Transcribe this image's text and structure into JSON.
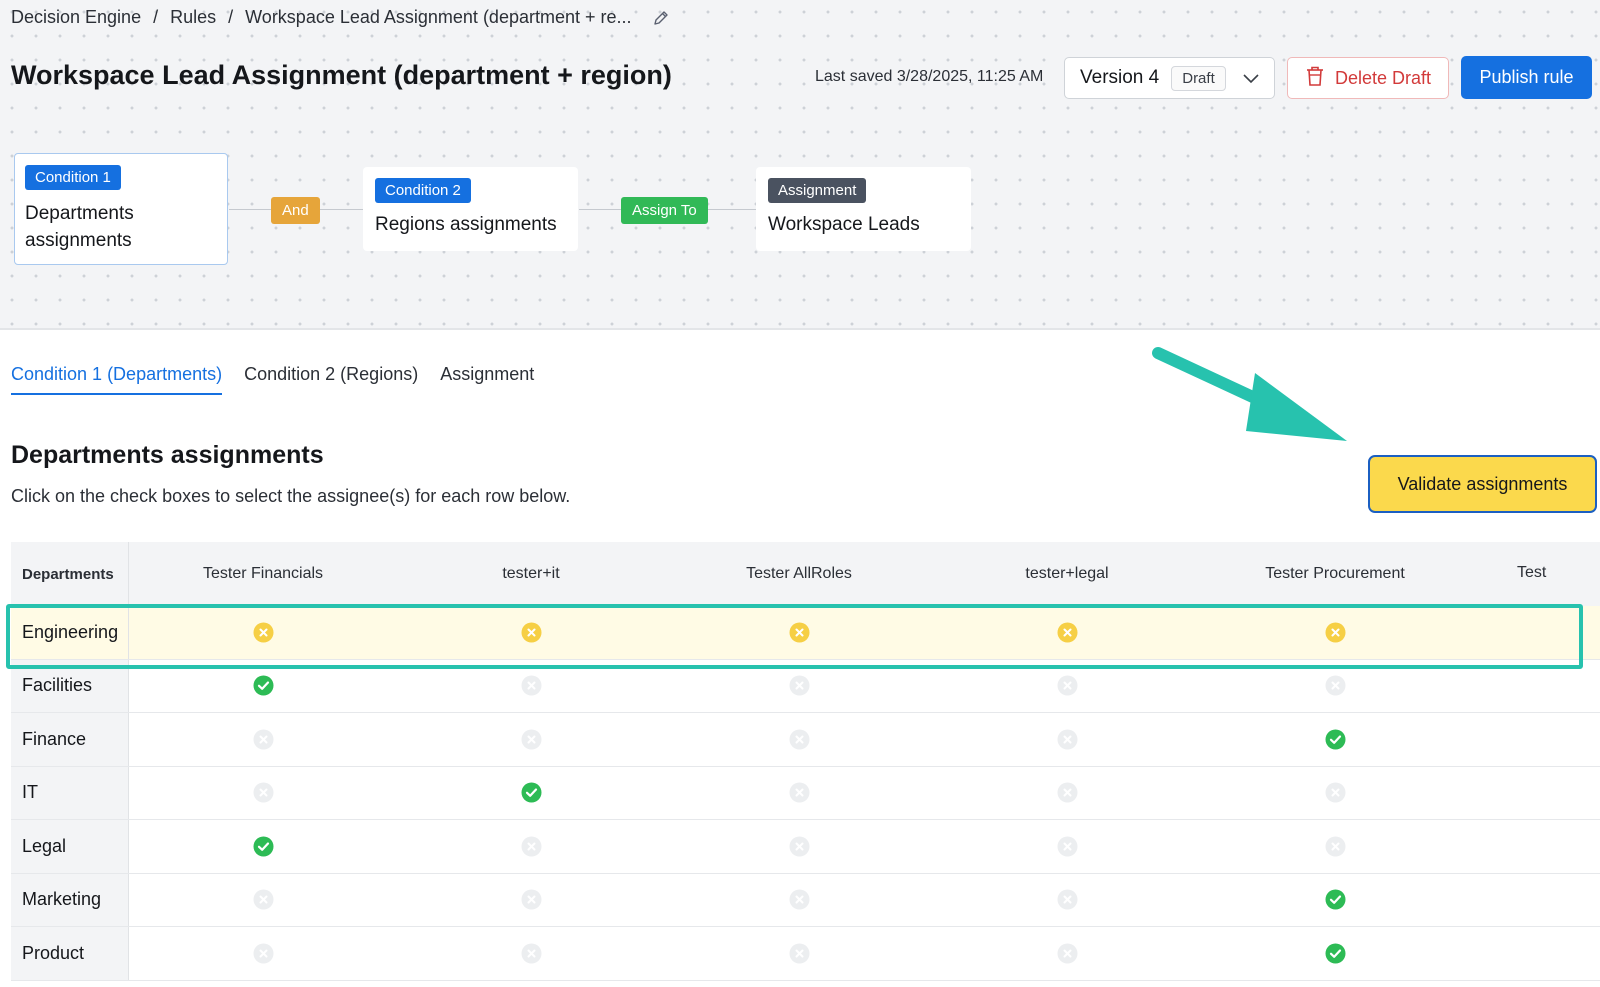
{
  "breadcrumb": {
    "items": [
      "Decision Engine",
      "Rules",
      "Workspace Lead Assignment (department + re..."
    ],
    "separator": "/"
  },
  "header": {
    "title": "Workspace Lead Assignment (department + region)",
    "last_saved": "Last saved 3/28/2025, 11:25 AM",
    "version_label": "Version 4",
    "version_status": "Draft",
    "delete_label": "Delete Draft",
    "publish_label": "Publish rule"
  },
  "flow": {
    "node1": {
      "tag": "Condition 1",
      "text_line1": "Departments",
      "text_line2": "assignments"
    },
    "connector1": "And",
    "node2": {
      "tag": "Condition 2",
      "text": "Regions assignments"
    },
    "connector2": "Assign To",
    "node3": {
      "tag": "Assignment",
      "text": "Workspace Leads"
    }
  },
  "tabs": [
    {
      "label": "Condition 1 (Departments)",
      "active": true
    },
    {
      "label": "Condition 2 (Regions)",
      "active": false
    },
    {
      "label": "Assignment",
      "active": false
    }
  ],
  "section": {
    "title": "Departments assignments",
    "subtitle": "Click on the check boxes to select the assignee(s) for each row below."
  },
  "validate_label": "Validate assignments",
  "table": {
    "first_header": "Departments",
    "columns": [
      "Tester Financials",
      "tester+it",
      "Tester AllRoles",
      "tester+legal",
      "Tester Procurement"
    ],
    "partial_column": "Test",
    "rows": [
      {
        "name": "Engineering",
        "cells": [
          "warning",
          "warning",
          "warning",
          "warning",
          "warning"
        ],
        "highlight": true
      },
      {
        "name": "Facilities",
        "cells": [
          "check",
          "empty",
          "empty",
          "empty",
          "empty"
        ]
      },
      {
        "name": "Finance",
        "cells": [
          "empty",
          "empty",
          "empty",
          "empty",
          "check"
        ]
      },
      {
        "name": "IT",
        "cells": [
          "empty",
          "check",
          "empty",
          "empty",
          "empty"
        ]
      },
      {
        "name": "Legal",
        "cells": [
          "check",
          "empty",
          "empty",
          "empty",
          "empty"
        ]
      },
      {
        "name": "Marketing",
        "cells": [
          "empty",
          "empty",
          "empty",
          "empty",
          "check"
        ]
      },
      {
        "name": "Product",
        "cells": [
          "empty",
          "empty",
          "empty",
          "empty",
          "check"
        ]
      }
    ]
  },
  "colors": {
    "accent": "#1570e0",
    "check": "#2dbb55",
    "warning": "#f6cf45",
    "empty": "#eceef0",
    "annotation": "#27c2ae"
  },
  "icons": {
    "check": "check-circle-icon",
    "warning": "warning-x-circle-icon",
    "empty": "unselected-x-circle-icon",
    "pencil": "pencil-icon",
    "chevron": "chevron-down-icon",
    "trash": "trash-icon"
  }
}
